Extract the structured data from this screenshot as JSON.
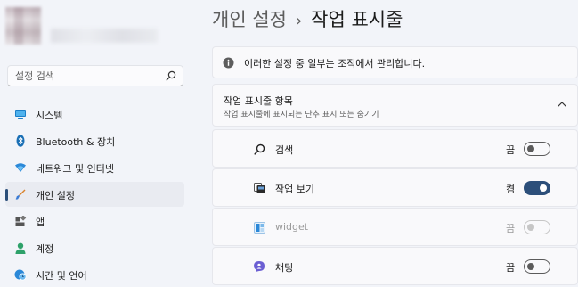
{
  "sidebar": {
    "search_placeholder": "설정 검색",
    "items": [
      {
        "label": "시스템",
        "icon": "monitor-icon"
      },
      {
        "label": "Bluetooth & 장치",
        "icon": "bluetooth-icon"
      },
      {
        "label": "네트워크 및 인터넷",
        "icon": "wifi-icon"
      },
      {
        "label": "개인 설정",
        "icon": "brush-icon",
        "active": true
      },
      {
        "label": "앱",
        "icon": "apps-icon"
      },
      {
        "label": "계정",
        "icon": "person-icon"
      },
      {
        "label": "시간 및 언어",
        "icon": "globe-clock-icon"
      }
    ]
  },
  "breadcrumb": {
    "parent": "개인 설정",
    "separator": "›",
    "current": "작업 표시줄"
  },
  "info_bar": {
    "text": "이러한 설정 중 일부는 조직에서 관리합니다.",
    "icon": "info-icon"
  },
  "section": {
    "title": "작업 표시줄 항목",
    "subtitle": "작업 표시줄에 표시되는 단추 표시 또는 숨기기",
    "expanded": true
  },
  "rows": [
    {
      "label": "검색",
      "state": "끔",
      "on": false,
      "disabled": false,
      "icon": "search-icon"
    },
    {
      "label": "작업 보기",
      "state": "켬",
      "on": true,
      "disabled": false,
      "icon": "task-view-icon"
    },
    {
      "label": "widget",
      "state": "끔",
      "on": false,
      "disabled": true,
      "icon": "widgets-icon"
    },
    {
      "label": "채팅",
      "state": "끔",
      "on": false,
      "disabled": false,
      "icon": "chat-icon"
    }
  ],
  "colors": {
    "accent": "#2c4f7a",
    "background": "#f2f4f9",
    "card": "#f9f9fb"
  }
}
